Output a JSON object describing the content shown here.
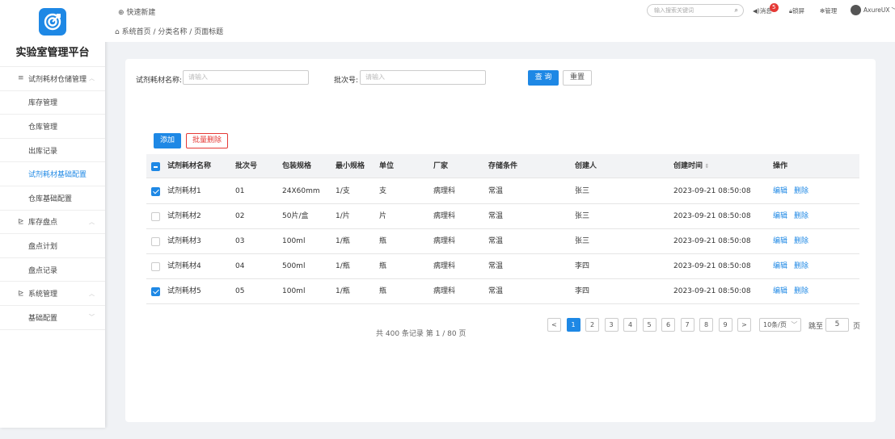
{
  "app": {
    "title": "实验室管理平台"
  },
  "sidebar": {
    "items": [
      {
        "label": "试剂耗材仓储管理",
        "type": "group",
        "icon": "menu-icon"
      },
      {
        "label": "库存管理",
        "type": "sub"
      },
      {
        "label": "仓库管理",
        "type": "sub"
      },
      {
        "label": "出库记录",
        "type": "sub"
      },
      {
        "label": "试剂耗材基础配置",
        "type": "sub",
        "active": true
      },
      {
        "label": "仓库基础配置",
        "type": "sub"
      },
      {
        "label": "库存盘点",
        "type": "group",
        "icon": "chart-icon"
      },
      {
        "label": "盘点计划",
        "type": "sub"
      },
      {
        "label": "盘点记录",
        "type": "sub"
      },
      {
        "label": "系统管理",
        "type": "group",
        "icon": "chart-icon"
      },
      {
        "label": "基础配置",
        "type": "sub"
      }
    ]
  },
  "topbar": {
    "quick_new": "快速新建",
    "breadcrumb": "系统首页 / 分类名称 / 页面标题",
    "search_placeholder": "输入搜索关键词",
    "messages": "消息",
    "message_count": "5",
    "lock": "锁屏",
    "manage": "管理",
    "user": "AxureUX"
  },
  "filters": {
    "name_label": "试剂耗材名称:",
    "name_placeholder": "请输入",
    "batch_label": "批次号:",
    "batch_placeholder": "请输入",
    "query": "查 询",
    "reset": "重置"
  },
  "actions": {
    "add": "添加",
    "batch_delete": "批量删除"
  },
  "table": {
    "headers": [
      "试剂耗材名称",
      "批次号",
      "包装规格",
      "最小规格",
      "单位",
      "厂家",
      "存储条件",
      "创建人",
      "创建时间",
      "操作"
    ],
    "rows": [
      {
        "checked": true,
        "cells": [
          "试剂耗材1",
          "01",
          "24X60mm",
          "1/支",
          "支",
          "病理科",
          "常温",
          "张三",
          "2023-09-21  08:50:08"
        ]
      },
      {
        "checked": false,
        "cells": [
          "试剂耗材2",
          "02",
          "50片/盒",
          "1/片",
          "片",
          "病理科",
          "常温",
          "张三",
          "2023-09-21  08:50:08"
        ]
      },
      {
        "checked": false,
        "cells": [
          "试剂耗材3",
          "03",
          "100ml",
          "1/瓶",
          "瓶",
          "病理科",
          "常温",
          "张三",
          "2023-09-21  08:50:08"
        ]
      },
      {
        "checked": false,
        "cells": [
          "试剂耗材4",
          "04",
          "500ml",
          "1/瓶",
          "瓶",
          "病理科",
          "常温",
          "李四",
          "2023-09-21  08:50:08"
        ]
      },
      {
        "checked": true,
        "cells": [
          "试剂耗材5",
          "05",
          "100ml",
          "1/瓶",
          "瓶",
          "病理科",
          "常温",
          "李四",
          "2023-09-21  08:50:08"
        ]
      }
    ],
    "edit": "编辑",
    "delete": "删除"
  },
  "pagination": {
    "total_text": "共 400 条记录 第 1 / 80 页",
    "pages": [
      "1",
      "2",
      "3",
      "4",
      "5",
      "6",
      "7",
      "8",
      "9"
    ],
    "current": "1",
    "prev": "<",
    "next": ">",
    "page_size": "10条/页",
    "jump_label": "跳至",
    "jump_value": "5",
    "page_unit": "页"
  },
  "colors": {
    "primary": "#1e88e5",
    "danger": "#e53935"
  }
}
